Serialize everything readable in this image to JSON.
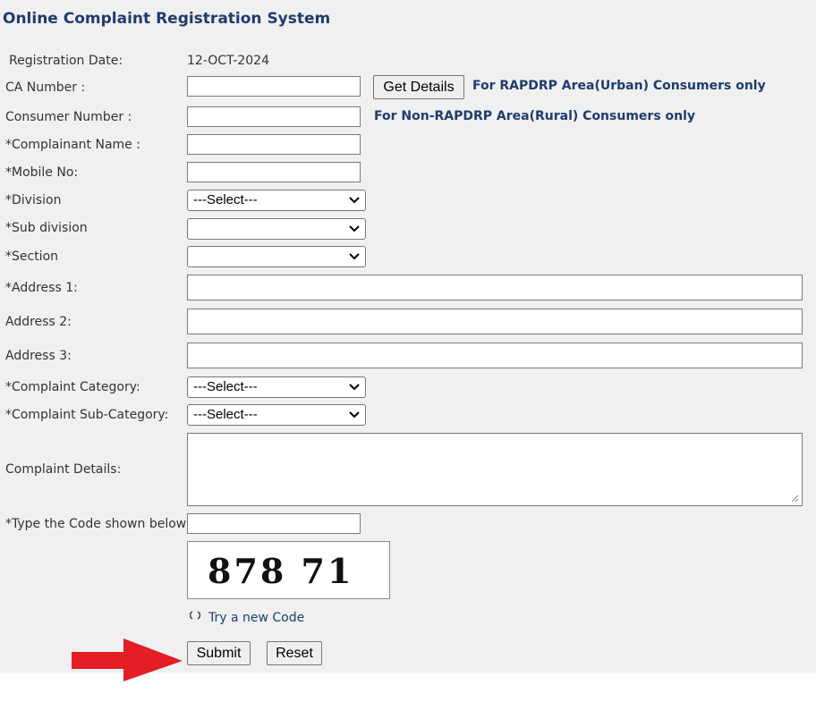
{
  "form": {
    "title": "Online Complaint Registration System",
    "registration_date_label": "Registration Date:",
    "registration_date_value": "12-OCT-2024",
    "ca_number_label": "CA Number :",
    "ca_number_value": "",
    "get_details_label": "Get Details",
    "urban_note": "For RAPDRP Area(Urban) Consumers only",
    "consumer_number_label": "Consumer Number :",
    "consumer_number_value": "",
    "rural_note": "For Non-RAPDRP Area(Rural) Consumers only",
    "complainant_name_label": "*Complainant Name :",
    "complainant_name_value": "",
    "mobile_label": "*Mobile No:",
    "mobile_value": "",
    "division_label": "*Division",
    "division_selected": "---Select---",
    "subdivision_label": "*Sub division",
    "subdivision_selected": "",
    "section_label": "*Section",
    "section_selected": "",
    "address1_label": "*Address 1:",
    "address1_value": "",
    "address2_label": "Address 2:",
    "address2_value": "",
    "address3_label": "Address 3:",
    "address3_value": "",
    "category_label": "*Complaint Category:",
    "category_selected": "---Select---",
    "subcategory_label": "*Complaint Sub-Category:",
    "subcategory_selected": "---Select---",
    "details_label": "Complaint Details:",
    "details_value": "",
    "code_label": "*Type the Code shown below",
    "code_value": "",
    "captcha_text": "878 71",
    "try_new_code": "Try a new Code",
    "submit_label": "Submit",
    "reset_label": "Reset"
  },
  "icons": {
    "dropdown": "chevron-down-icon",
    "refresh": "refresh-icon",
    "annotation": "red-arrow"
  },
  "colors": {
    "heading": "#1f3c6e",
    "panel_bg": "#f0f0f0",
    "arrow": "#e31e24"
  }
}
